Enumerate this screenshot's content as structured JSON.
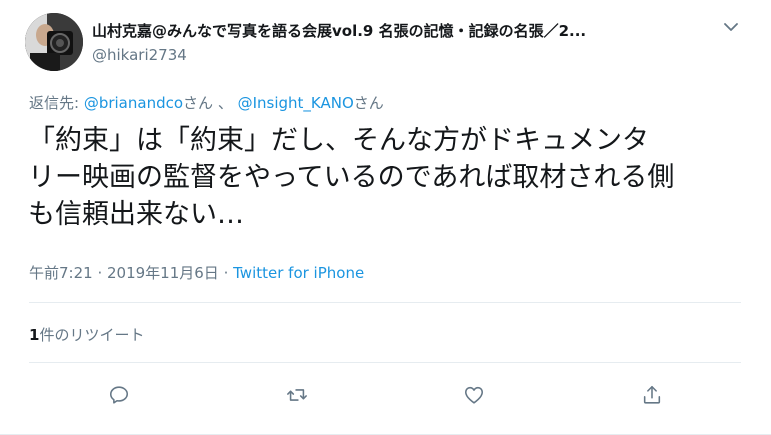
{
  "user": {
    "display_name": "山村克嘉@みんなで写真を語る会展vol.9 名張の記憶・記録の名張／2...",
    "handle": "@hikari2734"
  },
  "reply": {
    "prefix": "返信先: ",
    "mentions": [
      "@brianandco",
      "@Insight_KANO"
    ],
    "suffix": "さん",
    "separator": " 、 "
  },
  "tweet": {
    "lines": [
      "「約束」は「約束」だし、そんな方がドキュメンタ",
      "リー映画の監督をやっているのであれば取材される側",
      "も信頼出来ない…"
    ]
  },
  "meta": {
    "time": "午前7:21",
    "date": "2019年11月6日",
    "separator": " · ",
    "source": "Twitter for iPhone"
  },
  "stats": {
    "retweet_count": "1",
    "retweet_label": "件のリツイート"
  },
  "actions": {
    "reply_icon": "reply-icon",
    "retweet_icon": "retweet-icon",
    "like_icon": "heart-icon",
    "share_icon": "share-icon"
  },
  "colors": {
    "link": "#1b95e0",
    "secondary": "#657786",
    "text": "#14171a",
    "divider": "#e6ecf0"
  }
}
